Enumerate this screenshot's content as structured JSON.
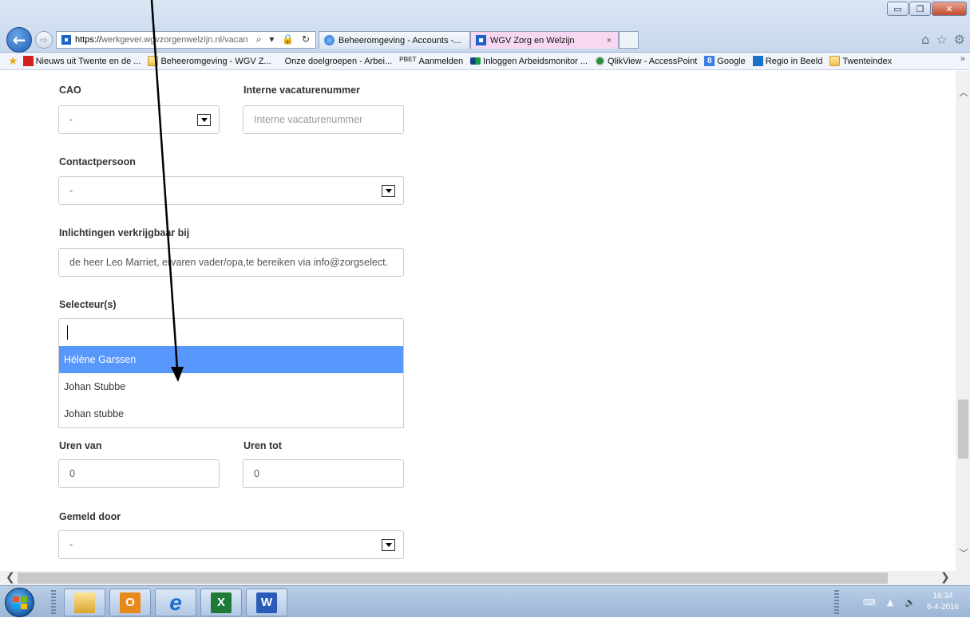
{
  "window": {
    "minimize_glyph": "▭",
    "restore_glyph": "❐",
    "close_glyph": "✕"
  },
  "browser": {
    "back_glyph": "←",
    "forward_glyph": "⇨",
    "address_prefix": "https://",
    "address_main": "werkgever.wgvzorgenwelzijn.nl",
    "address_rest": "/vacan",
    "address_icons": "⌕ ▾ 🔒 ↻",
    "tabs": [
      {
        "label": "Beheeromgeving - Accounts -...",
        "icon": "ie-icon",
        "active": false
      },
      {
        "label": "WGV Zorg en Welzijn",
        "icon": "site-icon",
        "active": true,
        "close": "×"
      }
    ],
    "right_icons": [
      "⌂",
      "☆",
      "⚙"
    ]
  },
  "favorites": {
    "star": "★",
    "items": [
      {
        "label": "Nieuws uit Twente en de ...",
        "icon": "red"
      },
      {
        "label": "Beheeromgeving - WGV Z...",
        "icon": "ie"
      },
      {
        "label": "Onze doelgroepen - Arbei...",
        "icon": "none"
      },
      {
        "label": "Aanmelden",
        "icon": "txt",
        "prefix": "PBET"
      },
      {
        "label": "Inloggen Arbeidsmonitor ...",
        "icon": "lock"
      },
      {
        "label": "QlikView - AccessPoint",
        "icon": "qlik"
      },
      {
        "label": "Google",
        "icon": "g"
      },
      {
        "label": "Regio in Beeld",
        "icon": "rib"
      },
      {
        "label": "Twenteindex",
        "icon": "ie"
      }
    ],
    "more": "»"
  },
  "form": {
    "cao": {
      "label": "CAO",
      "value": "-"
    },
    "interne": {
      "label": "Interne vacaturenummer",
      "placeholder": "Interne vacaturenummer"
    },
    "contactpersoon": {
      "label": "Contactpersoon",
      "value": "-"
    },
    "inlichtingen": {
      "label": "Inlichtingen verkrijgbaar bij",
      "value": "de heer Leo Marriet, ervaren vader/opa,te bereiken via info@zorgselect."
    },
    "selecteur": {
      "label": "Selecteur(s)",
      "value": "",
      "options": [
        "Hélène Garssen",
        "Johan Stubbe",
        "Johan stubbe"
      ],
      "highlighted": 0
    },
    "uren_van": {
      "label": "Uren van",
      "value": "0"
    },
    "uren_tot": {
      "label": "Uren tot",
      "value": "0"
    },
    "gemeld_door": {
      "label": "Gemeld door",
      "value": "-"
    }
  },
  "scroll": {
    "up": "︿",
    "down": "﹀",
    "left": "❮",
    "right": "❯"
  },
  "taskbar": {
    "apps": [
      {
        "name": "explorer",
        "glyph": "🗂"
      },
      {
        "name": "outlook",
        "glyph": "O"
      },
      {
        "name": "internet-explorer",
        "glyph": "e"
      },
      {
        "name": "excel",
        "glyph": "X"
      },
      {
        "name": "word",
        "glyph": "W"
      }
    ],
    "time": "16:34",
    "date": "6-4-2016",
    "tray_icons": [
      "⌨",
      "▲",
      "🔊"
    ]
  }
}
